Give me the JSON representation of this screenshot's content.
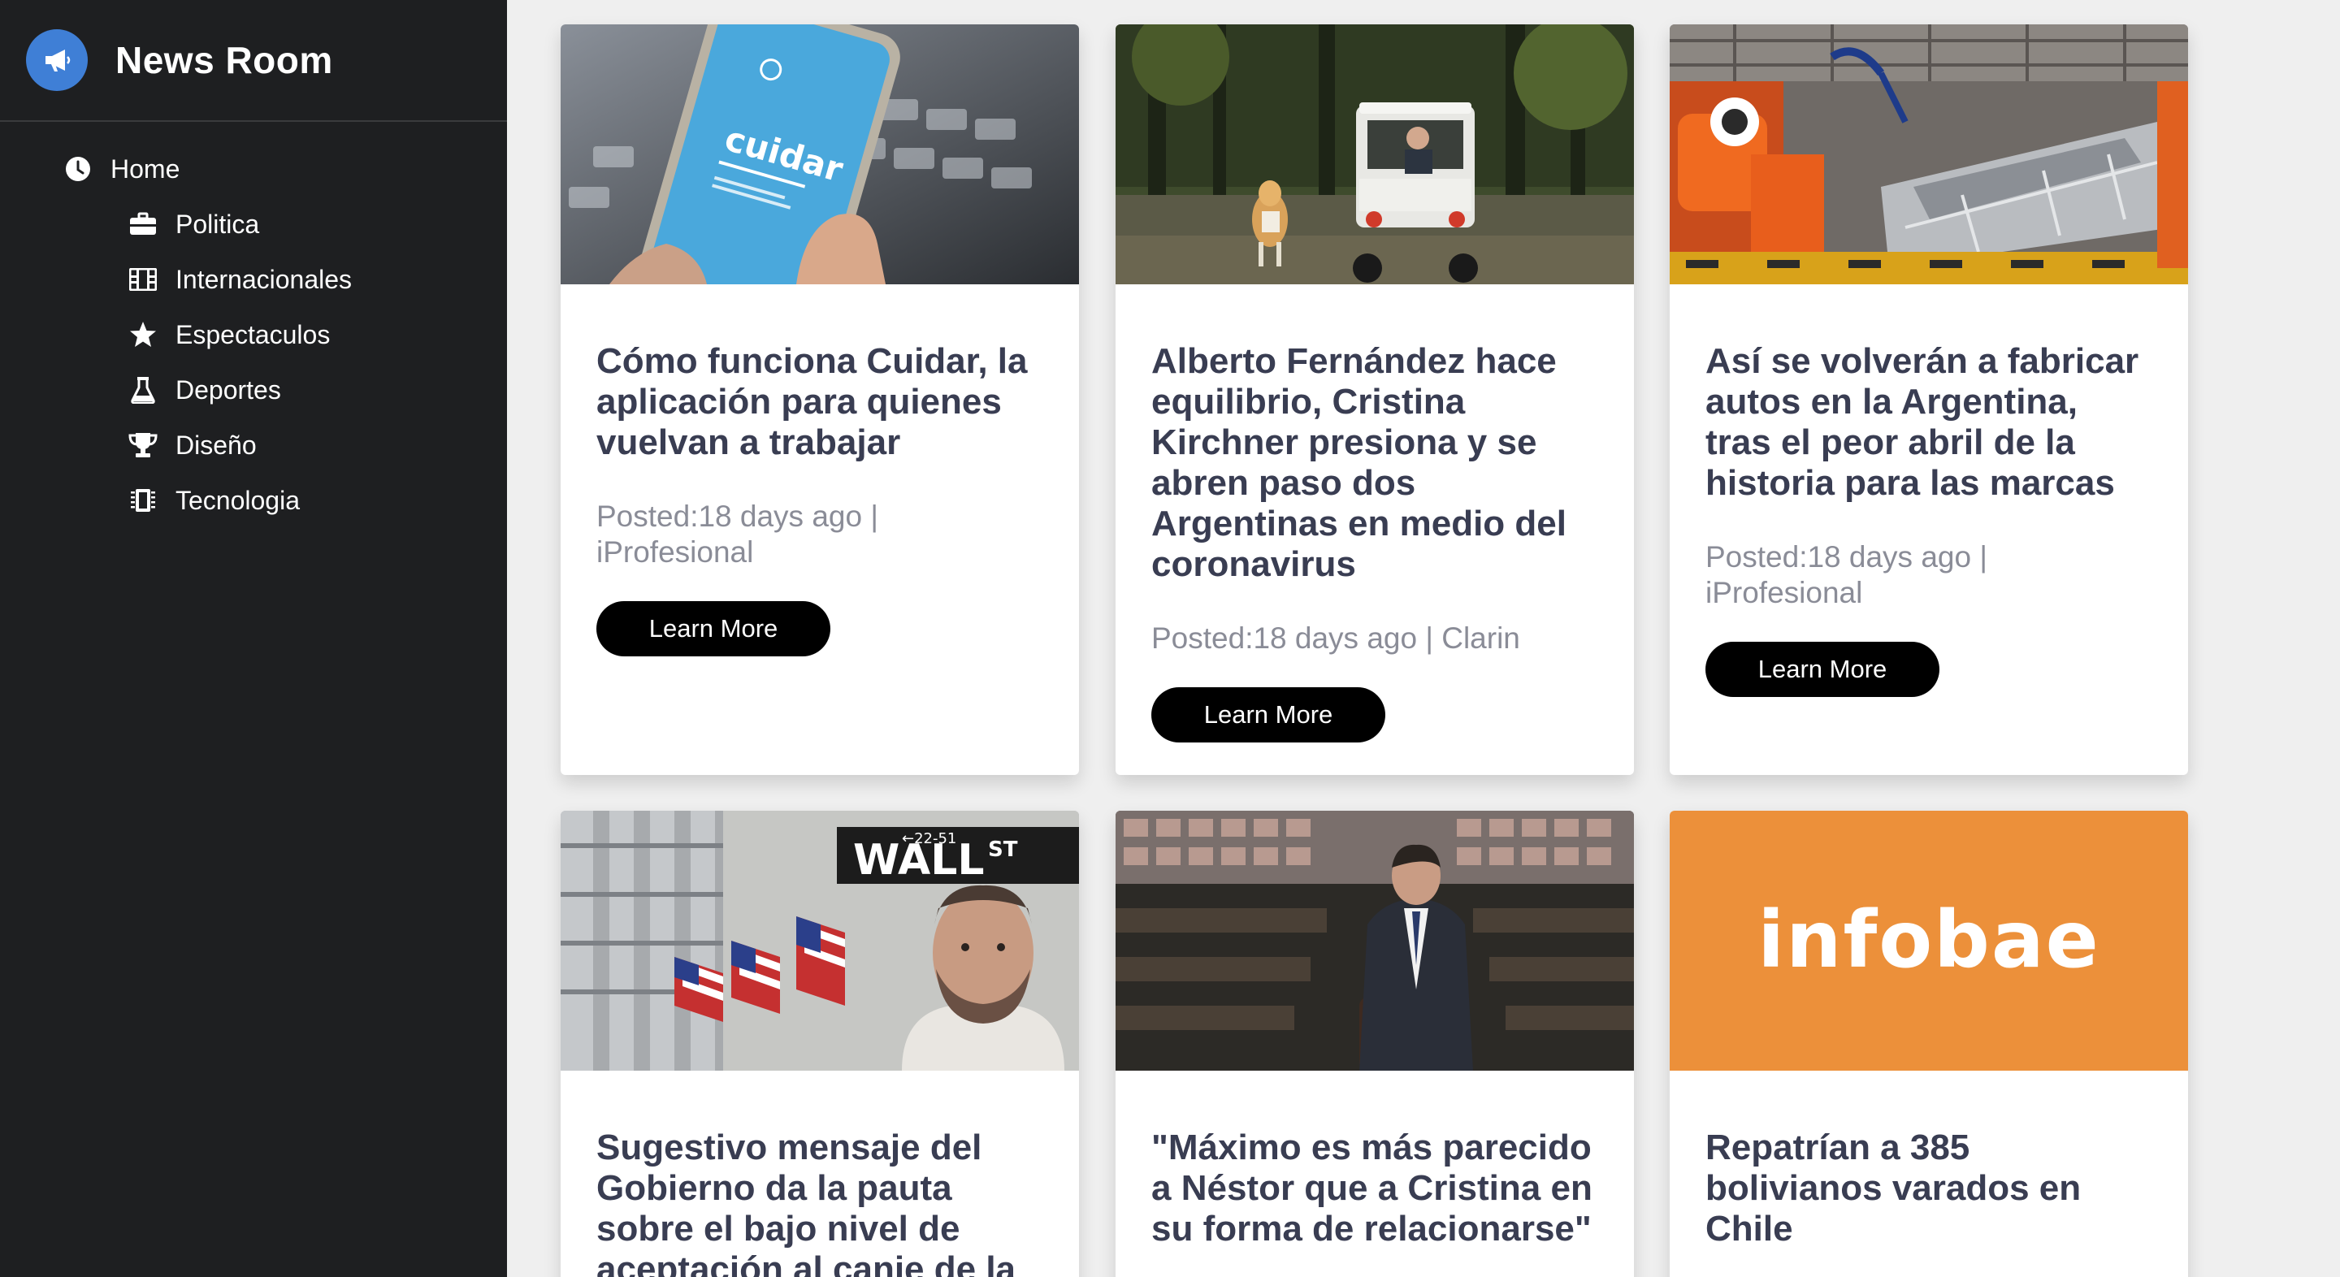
{
  "brand": {
    "title": "News Room",
    "icon": "megaphone-icon",
    "accent": "#3f7fd6"
  },
  "nav": {
    "home": {
      "label": "Home",
      "icon": "clock-icon"
    },
    "items": [
      {
        "label": "Politica",
        "icon": "briefcase-icon"
      },
      {
        "label": "Internacionales",
        "icon": "film-icon"
      },
      {
        "label": "Espectaculos",
        "icon": "star-icon"
      },
      {
        "label": "Deportes",
        "icon": "flask-icon"
      },
      {
        "label": "Diseño",
        "icon": "trophy-icon"
      },
      {
        "label": "Tecnologia",
        "icon": "chip-icon"
      }
    ]
  },
  "cards": [
    {
      "title": "Cómo funciona Cuidar, la aplicación para quienes vuelvan a trabajar",
      "meta": "Posted:18 days ago | iProfesional",
      "button": "Learn More",
      "image_text": "cuidar"
    },
    {
      "title": "Alberto Fernández hace equilibrio, Cristina Kirchner presiona y se abren paso dos Argentinas en medio del coronavirus",
      "meta": "Posted:18 days ago | Clarin",
      "button": "Learn More"
    },
    {
      "title": "Así se volverán a fabricar autos en la Argentina, tras el peor abril de la historia para las marcas",
      "meta": "Posted:18 days ago | iProfesional",
      "button": "Learn More"
    },
    {
      "title": "Sugestivo mensaje del Gobierno da la pauta sobre el bajo nivel de aceptación al canje de la",
      "image_text": {
        "sign": "WALL",
        "st": "ST",
        "num": "←22-51"
      }
    },
    {
      "title": "\"Máximo es más parecido a Néstor que a Cristina en su forma de relacionarse\""
    },
    {
      "title": "Repatrían a 385 bolivianos varados en Chile",
      "image_text": "infobae"
    }
  ]
}
